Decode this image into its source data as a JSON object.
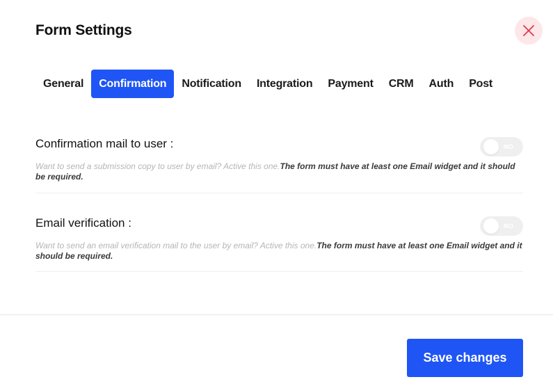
{
  "modal": {
    "title": "Form Settings",
    "close_icon": "close-x-icon",
    "close_bg_color": "#fde7e9",
    "close_icon_color": "#e2394c"
  },
  "tabs": [
    {
      "label": "General",
      "active": false
    },
    {
      "label": "Confirmation",
      "active": true
    },
    {
      "label": "Notification",
      "active": false
    },
    {
      "label": "Integration",
      "active": false
    },
    {
      "label": "Payment",
      "active": false
    },
    {
      "label": "CRM",
      "active": false
    },
    {
      "label": "Auth",
      "active": false
    },
    {
      "label": "Post",
      "active": false
    }
  ],
  "settings": {
    "confirmation_mail": {
      "label": "Confirmation mail to user :",
      "description": "Want to send a submission copy to user by email? Active this one.",
      "description_bold": "The form must have at least one Email widget and it should be required.",
      "toggle_label": "NO",
      "enabled": false
    },
    "email_verification": {
      "label": "Email verification :",
      "description": "Want to send an email verification mail to the user by email? Active this one.",
      "description_bold": "The form must have at least one Email widget and it should be required.",
      "toggle_label": "NO",
      "enabled": false
    }
  },
  "footer": {
    "save_label": "Save changes"
  },
  "colors": {
    "accent": "#1f55f5",
    "toggle_off": "#efefef"
  }
}
